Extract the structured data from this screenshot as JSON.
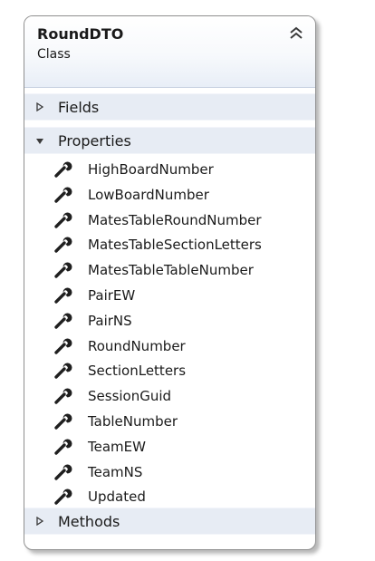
{
  "class": {
    "name": "RoundDTO",
    "kind": "Class"
  },
  "sections": {
    "fields": {
      "label": "Fields",
      "expanded": false
    },
    "properties": {
      "label": "Properties",
      "expanded": true,
      "items": [
        "HighBoardNumber",
        "LowBoardNumber",
        "MatesTableRoundNumber",
        "MatesTableSectionLetters",
        "MatesTableTableNumber",
        "PairEW",
        "PairNS",
        "RoundNumber",
        "SectionLetters",
        "SessionGuid",
        "TableNumber",
        "TeamEW",
        "TeamNS",
        "Updated"
      ]
    },
    "methods": {
      "label": "Methods",
      "expanded": false
    }
  },
  "icons": {
    "collapse": "double-chevron-up-icon",
    "collapsed_section": "triangle-right-icon",
    "expanded_section": "triangle-down-icon",
    "property": "wrench-icon"
  },
  "colors": {
    "section_header_bg": "#e7ecf4",
    "wrench": "#1f1f1f",
    "border": "#8f8f8f"
  }
}
